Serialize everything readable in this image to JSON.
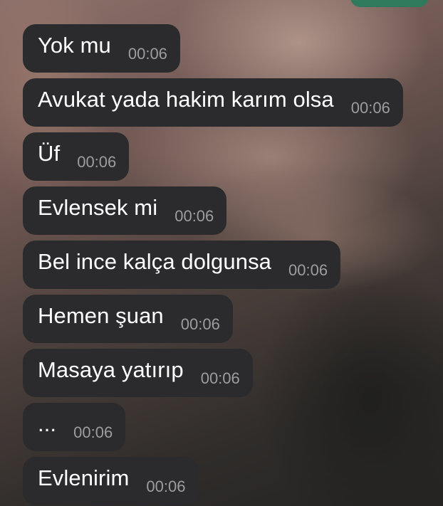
{
  "messages": [
    {
      "text": "Yok mu",
      "time": "00:06"
    },
    {
      "text": "Avukat yada hakim karım olsa",
      "time": "00:06"
    },
    {
      "text": "Üf",
      "time": "00:06"
    },
    {
      "text": "Evlensek mi",
      "time": "00:06"
    },
    {
      "text": "Bel ince kalça dolgunsa",
      "time": "00:06"
    },
    {
      "text": "Hemen şuan",
      "time": "00:06"
    },
    {
      "text": "Masaya yatırıp",
      "time": "00:06"
    },
    {
      "text": "...",
      "time": "00:06"
    },
    {
      "text": "Evlenirim",
      "time": "00:06"
    }
  ],
  "colors": {
    "incoming_bubble": "#2b2b2d",
    "outgoing_bubble": "#2f7a5c",
    "message_text": "#ffffff",
    "timestamp_text": "#9d9d9f"
  }
}
